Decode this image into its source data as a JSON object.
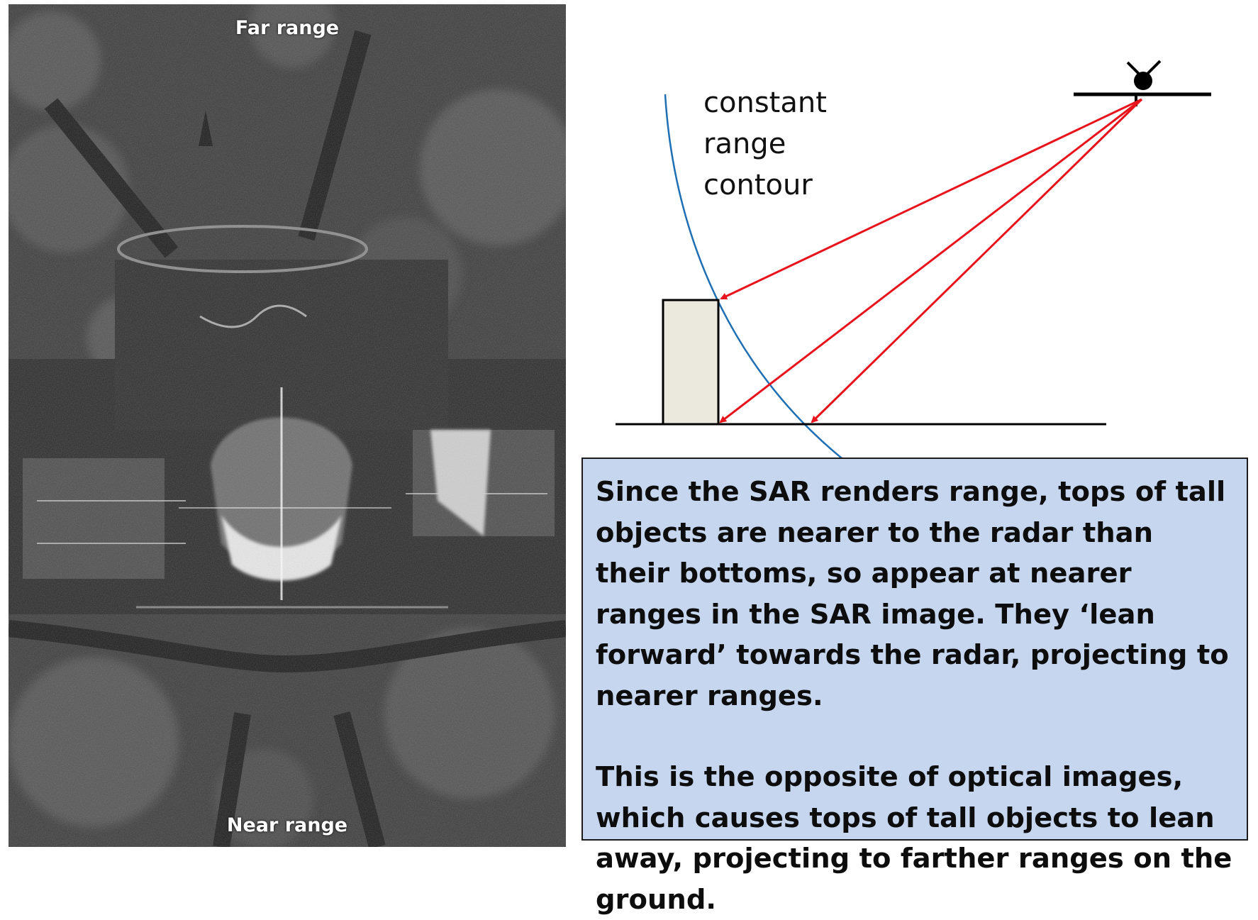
{
  "sar_image": {
    "far_label": "Far range",
    "near_label": "Near range"
  },
  "diagram": {
    "contour_label_lines": [
      "constant",
      "range",
      "contour"
    ],
    "colors": {
      "contour": "#1f6fb5",
      "rays": "#e8141c",
      "building_fill": "#ebe8de",
      "ground": "#000000",
      "caption_bg": "#c6d6ef"
    }
  },
  "caption": {
    "paragraph1": "Since the SAR renders range, tops of tall objects are nearer to the radar than their bottoms, so appear at nearer ranges in the SAR image.  They ‘lean forward’ towards the radar, projecting to nearer ranges.",
    "paragraph2": "This is the opposite of optical images, which causes tops of tall objects to lean away, projecting to farther ranges on the ground."
  }
}
